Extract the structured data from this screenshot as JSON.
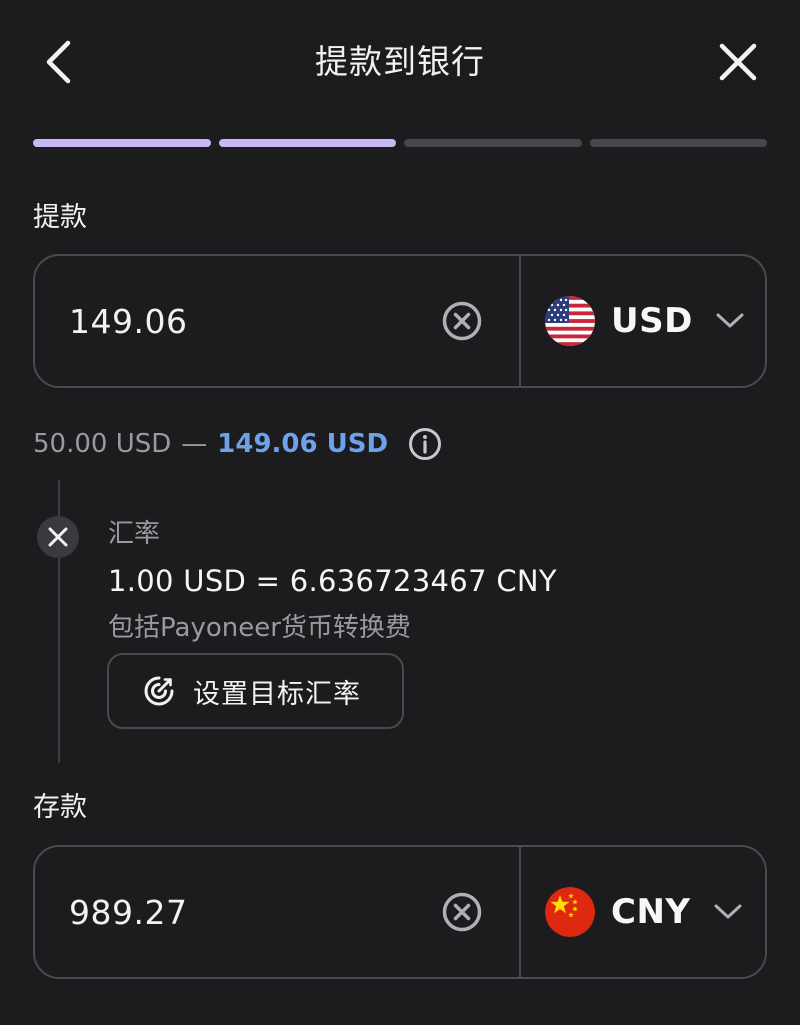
{
  "header": {
    "title": "提款到银行",
    "back_icon": "chevron-left-icon",
    "close_icon": "close-icon"
  },
  "progress": {
    "total_steps": 4,
    "completed_steps": 2,
    "active_color": "#c9b8f4",
    "inactive_color": "#48484c"
  },
  "withdraw": {
    "label": "提款",
    "amount": "149.06",
    "currency": "USD",
    "flag_icon": "us-flag-icon"
  },
  "limits": {
    "min": "50.00 USD",
    "separator": "—",
    "max": "149.06 USD",
    "max_color": "#6ea2e8"
  },
  "rate": {
    "label": "汇率",
    "value": "1.00 USD = 6.636723467 CNY",
    "note": "包括Payoneer货币转换费",
    "target_button": "设置目标汇率"
  },
  "deposit": {
    "label": "存款",
    "amount": "989.27",
    "currency": "CNY",
    "flag_icon": "cn-flag-icon"
  }
}
